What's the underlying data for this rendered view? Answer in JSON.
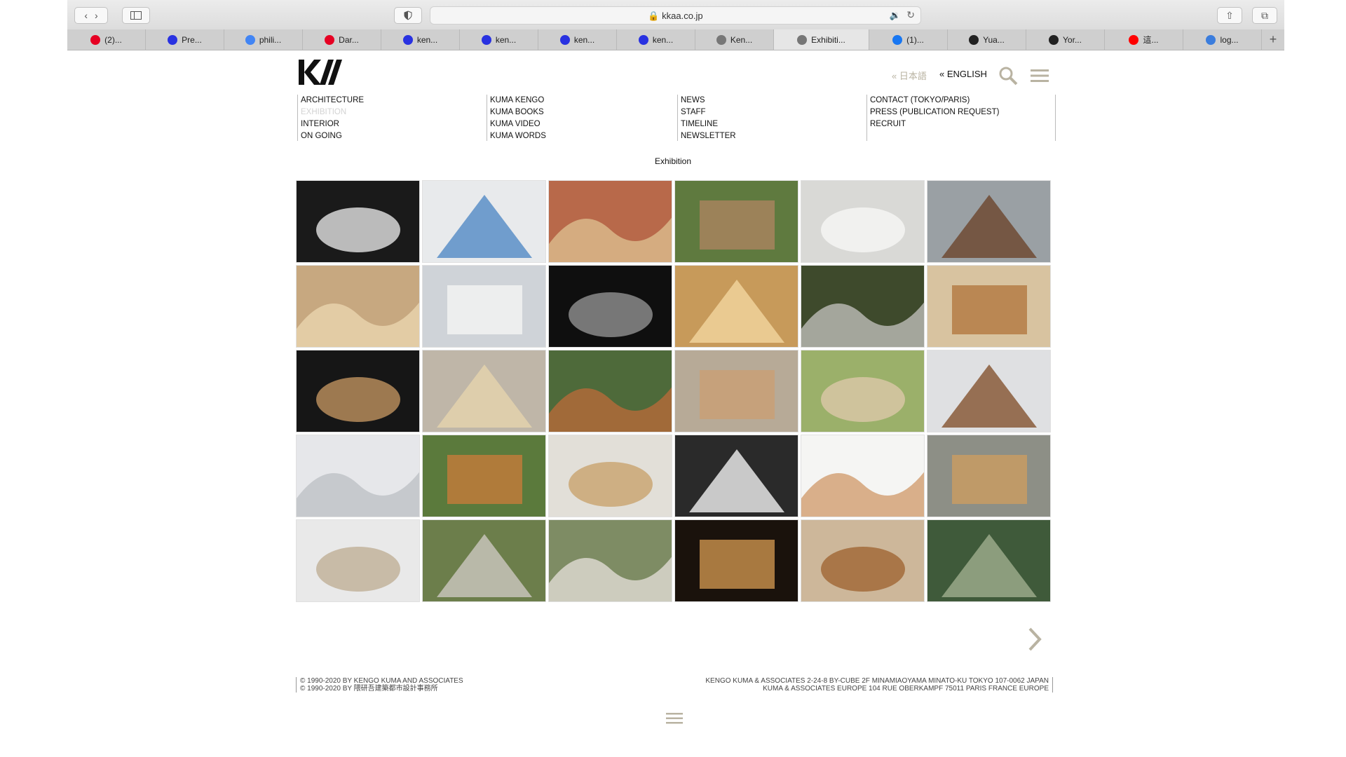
{
  "browser": {
    "url": "kkaa.co.jp",
    "tabs": [
      {
        "label": "(2)...",
        "icon": "pinterest-icon",
        "color": "#e60023"
      },
      {
        "label": "Pre...",
        "icon": "baidu-icon",
        "color": "#2932e1"
      },
      {
        "label": "phili...",
        "icon": "google-icon",
        "color": "#4285f4"
      },
      {
        "label": "Dar...",
        "icon": "pinterest-icon",
        "color": "#e60023"
      },
      {
        "label": "ken...",
        "icon": "baidu-icon",
        "color": "#2932e1"
      },
      {
        "label": "ken...",
        "icon": "baidu-icon",
        "color": "#2932e1"
      },
      {
        "label": "ken...",
        "icon": "baidu-icon",
        "color": "#2932e1"
      },
      {
        "label": "ken...",
        "icon": "baidu-icon",
        "color": "#2932e1"
      },
      {
        "label": "Ken...",
        "icon": "kkaa-icon",
        "color": "#777777"
      },
      {
        "label": "Exhibiti...",
        "icon": "kkaa-icon",
        "color": "#777777",
        "active": true
      },
      {
        "label": "(1)...",
        "icon": "facebook-icon",
        "color": "#1877f2"
      },
      {
        "label": "Yua...",
        "icon": "instagram-icon",
        "color": "#222222"
      },
      {
        "label": "Yor...",
        "icon": "dropbox-icon",
        "color": "#222222"
      },
      {
        "label": "這...",
        "icon": "youtube-icon",
        "color": "#ff0000"
      },
      {
        "label": "log...",
        "icon": "cloud-icon",
        "color": "#3b7ddd"
      }
    ]
  },
  "site": {
    "lang_jp": "« 日本語",
    "lang_en": "« ENGLISH",
    "nav": {
      "col1": [
        "ARCHITECTURE",
        "EXHIBITION",
        "INTERIOR",
        "ON GOING"
      ],
      "col2": [
        "KUMA KENGO",
        "KUMA BOOKS",
        "KUMA VIDEO",
        "KUMA WORDS"
      ],
      "col3": [
        "NEWS",
        "STAFF",
        "TIMELINE",
        "NEWSLETTER"
      ],
      "col4": [
        "CONTACT (TOKYO/PARIS)",
        "PRESS (PUBLICATION REQUEST)",
        "RECRUIT"
      ]
    },
    "current_nav": "EXHIBITION",
    "page_title": "Exhibition",
    "footer": {
      "left1": "© 1990-2020 BY KENGO KUMA AND ASSOCIATES",
      "left2": "© 1990-2020 BY 隈研吾建築都市設計事務所",
      "right1": "KENGO KUMA & ASSOCIATES 2-24-8 BY-CUBE 2F MINAMIAOYAMA MINATO-KU TOKYO 107-0062 JAPAN",
      "right2": "KUMA & ASSOCIATES EUROPE 104 RUE OBERKAMPF 75011 PARIS FRANCE EUROPE"
    },
    "accent_color": "#b9b3a2"
  },
  "gallery": [
    {
      "bg": "#1a1a1a",
      "fg": "#d8d8d8"
    },
    {
      "bg": "#e8eaec",
      "fg": "#5b8fc8"
    },
    {
      "bg": "#b8694a",
      "fg": "#d9b98a"
    },
    {
      "bg": "#5f7a3f",
      "fg": "#a7845e"
    },
    {
      "bg": "#d9d9d6",
      "fg": "#f5f5f3"
    },
    {
      "bg": "#9aa0a4",
      "fg": "#6e4a34"
    },
    {
      "bg": "#c7a880",
      "fg": "#e8d2ab"
    },
    {
      "bg": "#cfd3d8",
      "fg": "#f2f2f2"
    },
    {
      "bg": "#0f0f0f",
      "fg": "#8a8a8a"
    },
    {
      "bg": "#c79a5a",
      "fg": "#f0d29b"
    },
    {
      "bg": "#3e4a2c",
      "fg": "#b6b6b0"
    },
    {
      "bg": "#d8c3a0",
      "fg": "#b57d45"
    },
    {
      "bg": "#161616",
      "fg": "#b58b5a"
    },
    {
      "bg": "#bfb6a8",
      "fg": "#e3d2ad"
    },
    {
      "bg": "#4e6a3a",
      "fg": "#b06a3a"
    },
    {
      "bg": "#b7aa97",
      "fg": "#c9a075"
    },
    {
      "bg": "#9bb06a",
      "fg": "#d8c7a4"
    },
    {
      "bg": "#dfe0e2",
      "fg": "#8a5a3a"
    },
    {
      "bg": "#e6e7ea",
      "fg": "#bfc3c8"
    },
    {
      "bg": "#5b7a3c",
      "fg": "#c07b3a"
    },
    {
      "bg": "#e2dfd8",
      "fg": "#caa774"
    },
    {
      "bg": "#2a2a2a",
      "fg": "#e5e5e5"
    },
    {
      "bg": "#f5f5f3",
      "fg": "#d3a277"
    },
    {
      "bg": "#8d8f86",
      "fg": "#c89c63"
    },
    {
      "bg": "#e9e9e9",
      "fg": "#c2b39b"
    },
    {
      "bg": "#6c7e4b",
      "fg": "#c7c3ba"
    },
    {
      "bg": "#7e8c64",
      "fg": "#dad7ce"
    },
    {
      "bg": "#1a120c",
      "fg": "#c28c4a"
    },
    {
      "bg": "#cdb79a",
      "fg": "#a26b3a"
    },
    {
      "bg": "#3f5a3a",
      "fg": "#9aa98a"
    }
  ]
}
